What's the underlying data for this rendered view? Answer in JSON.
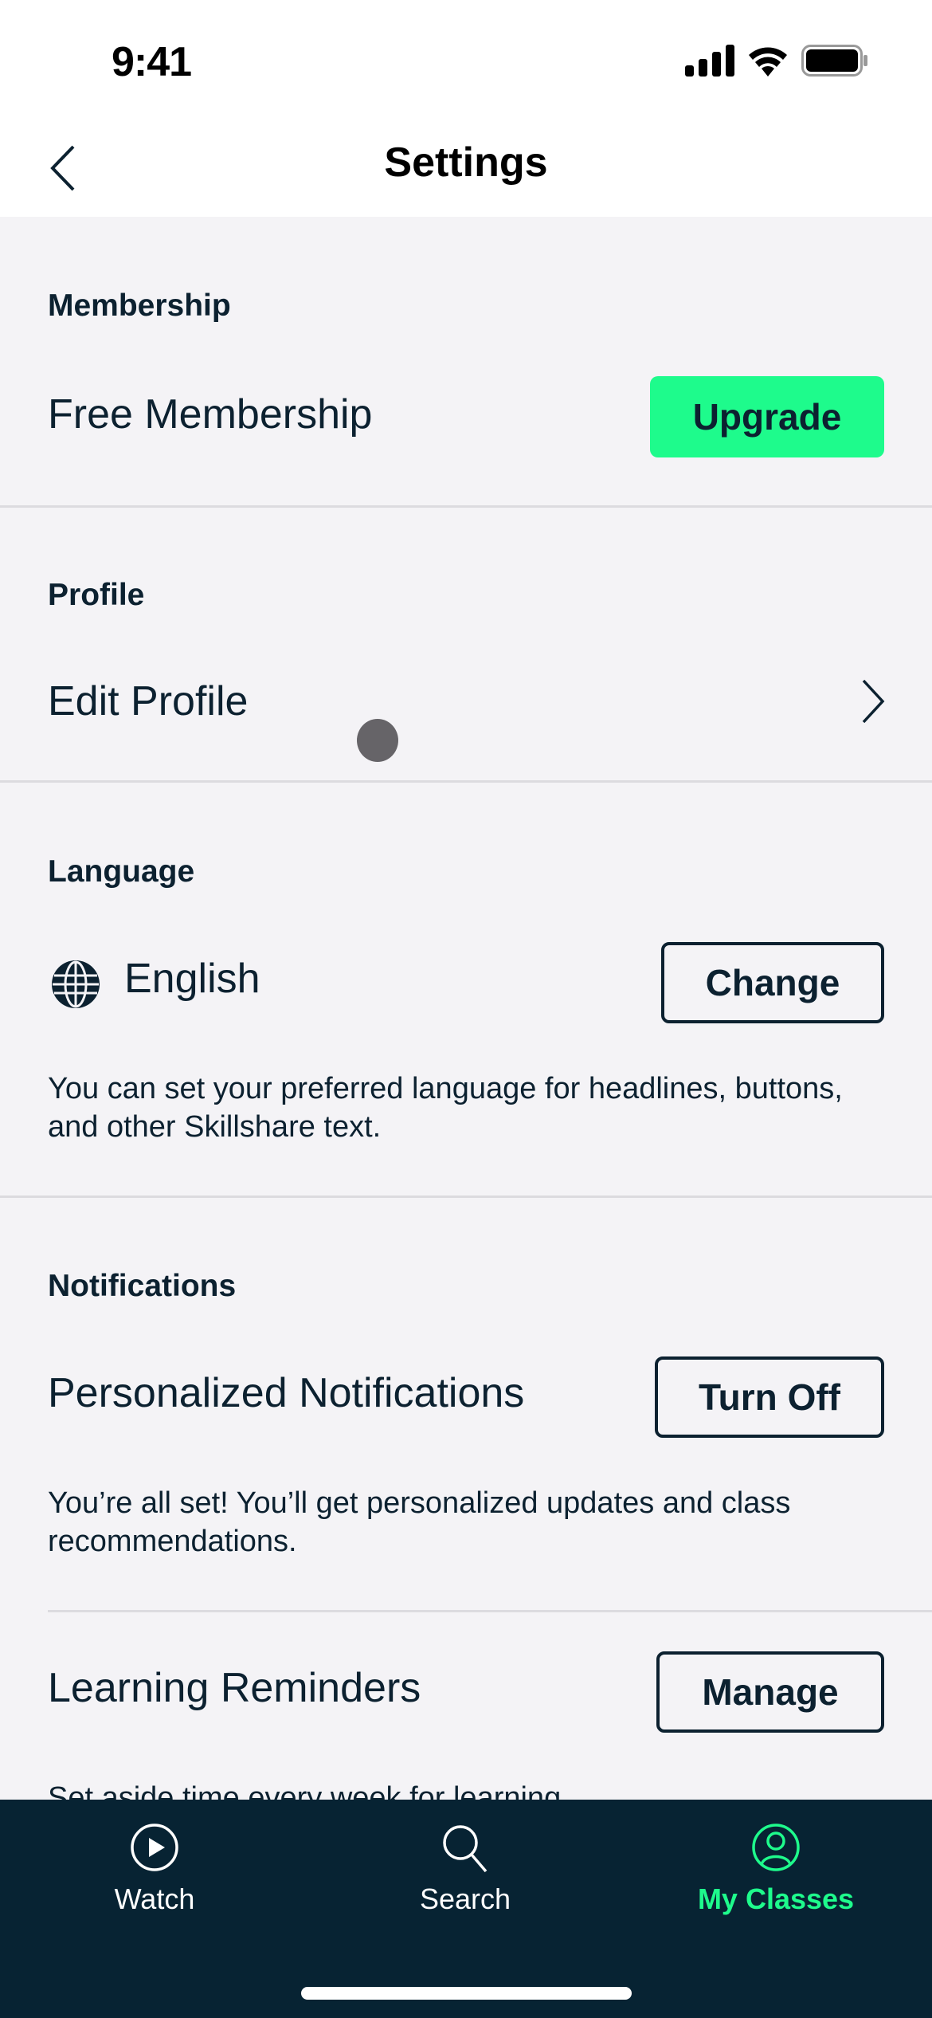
{
  "status_bar": {
    "time": "9:41",
    "icons": [
      "cellular-signal-icon",
      "wifi-icon",
      "battery-icon"
    ]
  },
  "nav": {
    "title": "Settings",
    "back_icon": "chevron-left-icon"
  },
  "sections": {
    "membership": {
      "header": "Membership",
      "row_label": "Free Membership",
      "button_label": "Upgrade"
    },
    "profile": {
      "header": "Profile",
      "row_label": "Edit Profile",
      "row_icon": "chevron-right-icon"
    },
    "language": {
      "header": "Language",
      "row_icon": "globe-icon",
      "row_label": "English",
      "button_label": "Change",
      "description": "You can set your preferred language for headlines, buttons, and other Skillshare text."
    },
    "notifications": {
      "header": "Notifications",
      "personalized": {
        "row_label": "Personalized Notifications",
        "button_label": "Turn Off",
        "description": "You’re all set! You’ll get personalized updates and class recommendations."
      },
      "reminders": {
        "row_label": "Learning Reminders",
        "button_label": "Manage",
        "description": "Set aside time every week for learning."
      }
    }
  },
  "tab_bar": {
    "tabs": [
      {
        "label": "Watch",
        "icon": "play-circle-icon",
        "active": false
      },
      {
        "label": "Search",
        "icon": "search-icon",
        "active": false
      },
      {
        "label": "My Classes",
        "icon": "user-circle-icon",
        "active": true
      }
    ]
  },
  "colors": {
    "accent_green": "#1EFB8C",
    "text_dark": "#0C2130",
    "tab_bar_bg": "#072333",
    "page_bg": "#F4F3F6"
  }
}
